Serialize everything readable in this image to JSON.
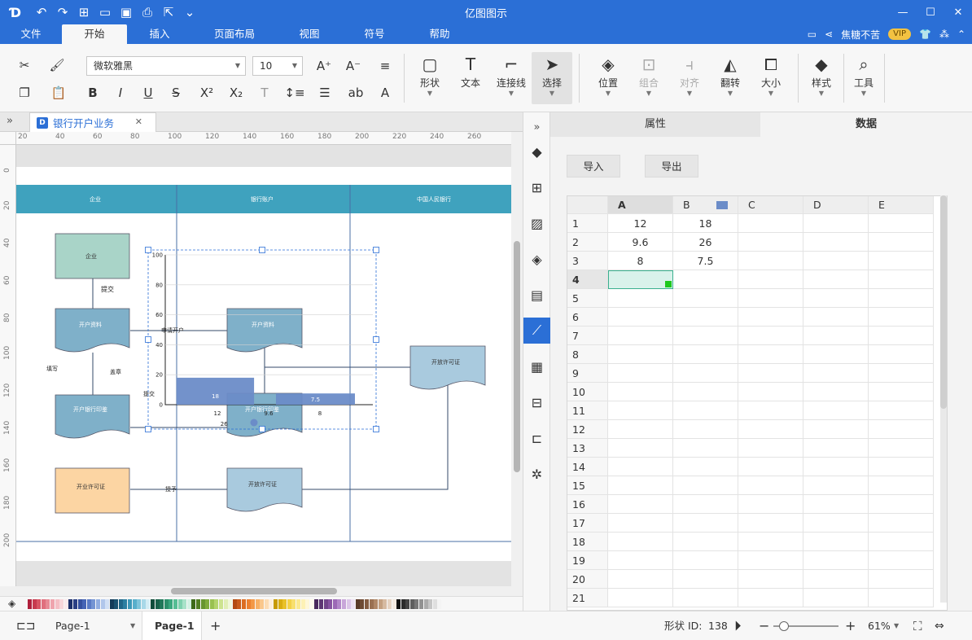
{
  "titlebar": {
    "title": "亿图图示"
  },
  "menu": {
    "tabs": [
      "文件",
      "开始",
      "插入",
      "页面布局",
      "视图",
      "符号",
      "帮助"
    ],
    "active": "开始",
    "user_name": "焦糖不苦",
    "vip_label": "VIP"
  },
  "ribbon": {
    "font_name": "微软雅黑",
    "font_size": "10",
    "tools": {
      "shape": "形状",
      "text": "文本",
      "connector": "连接线",
      "select": "选择",
      "position": "位置",
      "group": "组合",
      "align": "对齐",
      "flip": "翻转",
      "size": "大小",
      "style": "样式",
      "tools": "工具"
    }
  },
  "document": {
    "tab_name": "银行开户业务"
  },
  "ruler": {
    "h_ticks": [
      "20",
      "40",
      "60",
      "80",
      "100",
      "120",
      "140",
      "160",
      "180",
      "200",
      "220",
      "240",
      "260"
    ],
    "v_ticks": [
      "0",
      "20",
      "40",
      "60",
      "80",
      "100",
      "120",
      "140",
      "160",
      "180",
      "200"
    ]
  },
  "diagram": {
    "lanes": [
      "企业",
      "银行账户",
      "中国人民银行"
    ],
    "shapes": {
      "enterprise": "企业",
      "submit": "提交",
      "open_info_left": "开户资料",
      "apply_open": "申请开户",
      "open_info_mid": "开户资料",
      "fill": "填写",
      "stamp": "盖章",
      "bank_seal_left": "开户银行印鉴",
      "submit2": "提交",
      "bank_seal_mid": "开户银行印鉴",
      "license": "开放许可证",
      "license_left": "开业许可证",
      "grant": "授予",
      "license_mid": "开放许可证"
    }
  },
  "chart_data": {
    "type": "bar",
    "categories": [
      "12",
      "9.6",
      "8"
    ],
    "series": [
      {
        "values": [
          18,
          26,
          7.5
        ]
      }
    ],
    "ylim": [
      0,
      100
    ],
    "yticks": [
      "0",
      "20",
      "40",
      "60",
      "80",
      "100"
    ],
    "bar_color": "#6b8cc8"
  },
  "panel": {
    "tab_properties": "属性",
    "tab_data": "数据",
    "import_label": "导入",
    "export_label": "导出",
    "columns": [
      "A",
      "B",
      "C",
      "D",
      "E"
    ],
    "rows": [
      "1",
      "2",
      "3",
      "4",
      "5",
      "6",
      "7",
      "8",
      "9",
      "10",
      "11",
      "12",
      "13",
      "14",
      "15",
      "16",
      "17",
      "18",
      "19",
      "20",
      "21"
    ],
    "cells": [
      [
        "12",
        "18"
      ],
      [
        "9.6",
        "26"
      ],
      [
        "8",
        "7.5"
      ]
    ],
    "series_color": "#6b8cc8"
  },
  "status": {
    "page_select": "Page-1",
    "page_tab": "Page-1",
    "shape_id_label": "形状 ID:",
    "shape_id": "138",
    "zoom": "61%"
  }
}
